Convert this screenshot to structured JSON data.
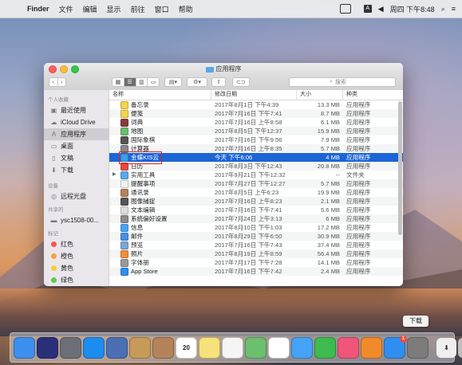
{
  "menubar": {
    "app": "Finder",
    "items": [
      "文件",
      "编辑",
      "显示",
      "前往",
      "窗口",
      "帮助"
    ],
    "clock": "周四 下午8:48"
  },
  "window": {
    "title": "应用程序",
    "search_placeholder": "搜索"
  },
  "sidebar": {
    "sections": [
      {
        "header": "个人收藏",
        "items": [
          {
            "label": "最近使用",
            "icon": "recents-icon"
          },
          {
            "label": "iCloud Drive",
            "icon": "cloud-icon"
          },
          {
            "label": "应用程序",
            "icon": "applications-icon",
            "selected": true
          },
          {
            "label": "桌面",
            "icon": "desktop-icon"
          },
          {
            "label": "文稿",
            "icon": "documents-icon"
          },
          {
            "label": "下载",
            "icon": "downloads-icon"
          }
        ]
      },
      {
        "header": "设备",
        "items": [
          {
            "label": "远程光盘",
            "icon": "disc-icon"
          }
        ]
      },
      {
        "header": "共享的",
        "items": [
          {
            "label": "ysc1508-00...",
            "icon": "computer-icon"
          }
        ]
      },
      {
        "header": "标记",
        "items": [
          {
            "label": "红色",
            "color": "#f5584f"
          },
          {
            "label": "橙色",
            "color": "#f7a33b"
          },
          {
            "label": "黄色",
            "color": "#f5cd35"
          },
          {
            "label": "绿色",
            "color": "#5fcb4c"
          }
        ]
      }
    ]
  },
  "columns": {
    "name": "名称",
    "date": "修改日期",
    "size": "大小",
    "kind": "种类"
  },
  "files": [
    {
      "name": "备忘录",
      "date": "2017年8月1日 下午4:39",
      "size": "13.3 MB",
      "kind": "应用程序",
      "color": "#f6d34a"
    },
    {
      "name": "便笺",
      "date": "2017年7月16日 下午7:41",
      "size": "8.7 MB",
      "kind": "应用程序",
      "color": "#f3d552"
    },
    {
      "name": "词典",
      "date": "2017年7月16日 上午8:58",
      "size": "6.1 MB",
      "kind": "应用程序",
      "color": "#8b3a3a"
    },
    {
      "name": "地图",
      "date": "2017年8月5日 下午12:37",
      "size": "15.9 MB",
      "kind": "应用程序",
      "color": "#6cbf6c"
    },
    {
      "name": "国际象棋",
      "date": "2017年7月16日 下午9:56",
      "size": "7.9 MB",
      "kind": "应用程序",
      "color": "#555555"
    },
    {
      "name": "计算器",
      "date": "2017年7月16日 上午8:35",
      "size": "5.7 MB",
      "kind": "应用程序",
      "color": "#888888"
    },
    {
      "name": "金蝶KIS云",
      "date": "今天 下午6:06",
      "size": "4 MB",
      "kind": "应用程序",
      "color": "#3aa0e8",
      "selected": true
    },
    {
      "name": "日历",
      "date": "2017年8月3日 下午12:43",
      "size": "20.8 MB",
      "kind": "应用程序",
      "color": "#e94a3f"
    },
    {
      "name": "实用工具",
      "date": "2017年9月21日 下午12:32",
      "size": "--",
      "kind": "文件夹",
      "color": "#5aa9ea",
      "folder": true
    },
    {
      "name": "提醒事项",
      "date": "2017年7月27日 下午12:27",
      "size": "5.7 MB",
      "kind": "应用程序",
      "color": "#f2f2f2"
    },
    {
      "name": "通讯录",
      "date": "2017年8月5日 上午6:23",
      "size": "19.9 MB",
      "kind": "应用程序",
      "color": "#b5835a"
    },
    {
      "name": "图像捕捉",
      "date": "2017年7月16日 上午8:23",
      "size": "2.1 MB",
      "kind": "应用程序",
      "color": "#555555"
    },
    {
      "name": "文本编辑",
      "date": "2017年7月16日 下午7:41",
      "size": "5.6 MB",
      "kind": "应用程序",
      "color": "#dddddd"
    },
    {
      "name": "系统偏好设置",
      "date": "2017年7月24日 上午3:13",
      "size": "6 MB",
      "kind": "应用程序",
      "color": "#8a8a8a"
    },
    {
      "name": "信息",
      "date": "2017年8月10日 下午1:03",
      "size": "17.2 MB",
      "kind": "应用程序",
      "color": "#45a3f5"
    },
    {
      "name": "邮件",
      "date": "2017年8月29日 下午6:50",
      "size": "30.9 MB",
      "kind": "应用程序",
      "color": "#4a8fe3"
    },
    {
      "name": "预览",
      "date": "2017年7月16日 下午7:43",
      "size": "37.4 MB",
      "kind": "应用程序",
      "color": "#7aa5d6"
    },
    {
      "name": "照片",
      "date": "2017年8月19日 上午8:59",
      "size": "56.4 MB",
      "kind": "应用程序",
      "color": "#f08e3a"
    },
    {
      "name": "字体册",
      "date": "2017年7月17日 下午7:28",
      "size": "14.1 MB",
      "kind": "应用程序",
      "color": "#999999"
    },
    {
      "name": "App Store",
      "date": "2017年7月16日 下午7:42",
      "size": "2.4 MB",
      "kind": "应用程序",
      "color": "#2f8ef0"
    }
  ],
  "dock": {
    "tooltip": "下载",
    "calendar_day": "20",
    "badge": "1",
    "apps": [
      {
        "name": "finder-icon",
        "color": "#3d8ff0"
      },
      {
        "name": "siri-icon",
        "color": "#2a2f7a"
      },
      {
        "name": "launchpad-icon",
        "color": "#6b6f78"
      },
      {
        "name": "safari-icon",
        "color": "#1c8cf0"
      },
      {
        "name": "photo-browser-icon",
        "color": "#4a6fb5"
      },
      {
        "name": "notes-folder-icon",
        "color": "#c69a58"
      },
      {
        "name": "contacts-icon",
        "color": "#b5835a"
      },
      {
        "name": "calendar-icon",
        "color": "#ffffff"
      },
      {
        "name": "notes-icon",
        "color": "#f6e27a"
      },
      {
        "name": "reminders-icon",
        "color": "#f5f5f5"
      },
      {
        "name": "maps-icon",
        "color": "#6cbf6c"
      },
      {
        "name": "photos-icon",
        "color": "#ffffff"
      },
      {
        "name": "messages-icon",
        "color": "#45a3f5"
      },
      {
        "name": "facetime-icon",
        "color": "#3dbb4e"
      },
      {
        "name": "music-icon",
        "color": "#f0567a"
      },
      {
        "name": "books-icon",
        "color": "#f08a2a"
      },
      {
        "name": "appstore-icon",
        "color": "#2f8ef0"
      },
      {
        "name": "system-prefs-icon",
        "color": "#7c7c7c"
      }
    ]
  }
}
